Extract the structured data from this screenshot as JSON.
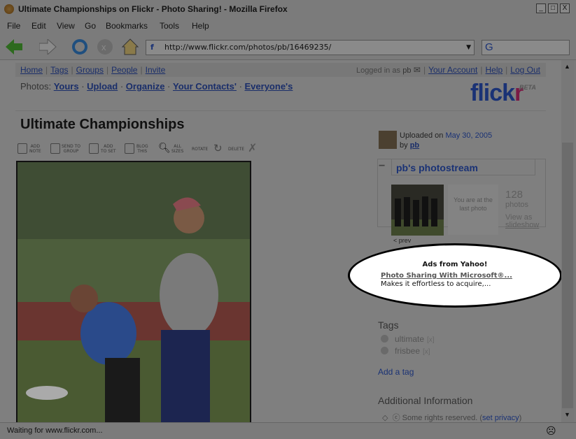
{
  "window": {
    "title": "Ultimate Championships on Flickr - Photo Sharing! - Mozilla Firefox"
  },
  "menu": [
    "File",
    "Edit",
    "View",
    "Go",
    "Bookmarks",
    "Tools",
    "Help"
  ],
  "address": {
    "url": "http://www.flickr.com/photos/pb/16469235/"
  },
  "nav": {
    "items": [
      "Home",
      "Tags",
      "Groups",
      "People",
      "Invite"
    ],
    "logged_in": "Logged in as",
    "user": "pb",
    "account": "Your Account",
    "help": "Help",
    "logout": "Log Out"
  },
  "photos_nav": {
    "label": "Photos:",
    "items": [
      "Yours",
      "Upload",
      "Organize",
      "Your Contacts'",
      "Everyone's"
    ]
  },
  "logo": {
    "text_a": "flick",
    "text_b": "r",
    "beta": "BETA"
  },
  "photo": {
    "title": "Ultimate Championships"
  },
  "tools": [
    {
      "l1": "ADD",
      "l2": "NOTE"
    },
    {
      "l1": "SEND TO",
      "l2": "GROUP"
    },
    {
      "l1": "ADD",
      "l2": "TO SET"
    },
    {
      "l1": "BLOG",
      "l2": "THIS"
    },
    {
      "l1": "ALL",
      "l2": "SIZES"
    },
    {
      "l1": "ROTATE",
      "l2": ""
    },
    {
      "l1": "DELETE",
      "l2": ""
    }
  ],
  "sidebar": {
    "uploaded_on": "Uploaded on",
    "date": "May 30, 2005",
    "by": "by",
    "user": "pb",
    "photostream": "pb's photostream",
    "prev": "< prev",
    "last_photo": "You are at the last photo",
    "count": "128",
    "count_label": "photos",
    "view_as": "View as",
    "slideshow": "slideshow",
    "tags_heading": "Tags",
    "tags": [
      "ultimate",
      "frisbee"
    ],
    "tag_remove": "[x]",
    "add_tag": "Add a tag",
    "additional_heading": "Additional Information",
    "rights": "Some rights reserved.",
    "set_privacy": "set privacy"
  },
  "ad": {
    "heading": "Ads from Yahoo!",
    "link": "Photo Sharing With Microsoft®...",
    "desc": "Makes it effortless to acquire,..."
  },
  "status": {
    "text": "Waiting for www.flickr.com..."
  }
}
